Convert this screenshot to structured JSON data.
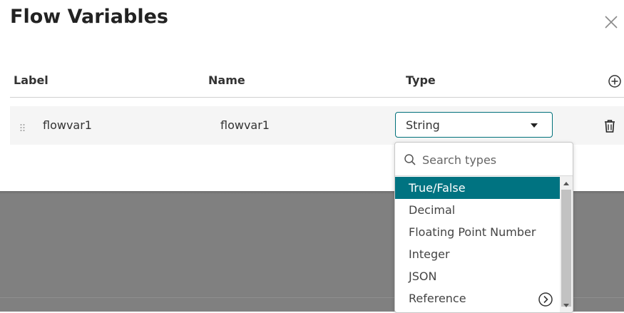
{
  "dialog": {
    "title": "Flow Variables",
    "close_icon": "close-icon",
    "add_icon": "plus-circle-icon"
  },
  "columns": {
    "label": "Label",
    "name": "Name",
    "type": "Type"
  },
  "rows": [
    {
      "label": "flowvar1",
      "name": "flowvar1",
      "type": "String",
      "delete_icon": "trash-icon",
      "drag_icon": "drag-handle-icon"
    }
  ],
  "type_dropdown": {
    "search_placeholder": "Search types",
    "search_icon": "search-icon",
    "options": [
      {
        "label": "True/False",
        "selected": true
      },
      {
        "label": "Decimal",
        "selected": false
      },
      {
        "label": "Floating Point Number",
        "selected": false
      },
      {
        "label": "Integer",
        "selected": false
      },
      {
        "label": "JSON",
        "selected": false
      },
      {
        "label": "Reference",
        "selected": false,
        "has_submenu": true
      }
    ]
  },
  "colors": {
    "accent": "#007381",
    "select_border": "#00707a",
    "backdrop": "#808080",
    "row_bg": "#f5f5f5"
  }
}
